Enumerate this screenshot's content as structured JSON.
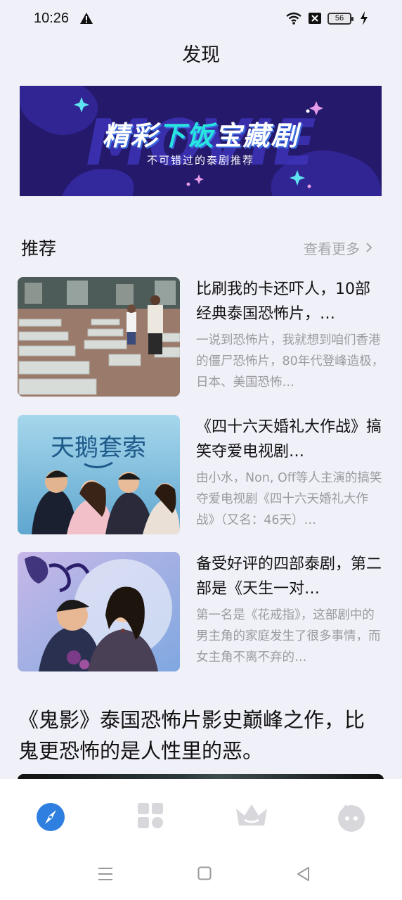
{
  "status_bar": {
    "time": "10:26",
    "battery": "56"
  },
  "header": {
    "title": "发现"
  },
  "banner": {
    "title_prefix": "精彩",
    "title_highlight": "下饭",
    "title_suffix": "宝藏剧",
    "watermark": "MOVIE",
    "subtitle": "不可错过的泰剧推荐"
  },
  "section": {
    "title": "推荐",
    "more_label": "查看更多"
  },
  "articles": [
    {
      "title": "比刷我的卡还吓人，10部经典泰国恐怖片，…",
      "desc": "一说到恐怖片，我就想到咱们香港的僵尸恐怖片，80年代登峰造极，日本、美国恐怖…"
    },
    {
      "title": "《四十六天婚礼大作战》搞笑夺爱电视剧…",
      "desc": "由小水，Non, Off等人主演的搞笑夺爱电视剧《四十六天婚礼大作战》（又名：46天）…",
      "image_caption": "天鹅套索"
    },
    {
      "title": "备受好评的四部泰剧，第二部是《天生一对…",
      "desc": "第一名是《花戒指》，这部剧中的男主角的家庭发生了很多事情，而女主角不离不弃的…"
    }
  ],
  "feature": {
    "title": "《鬼影》泰国恐怖片影史巅峰之作，比鬼更恐怖的是人性里的恶。"
  },
  "bottom_nav": {
    "items": [
      {
        "icon": "compass-icon",
        "active": true
      },
      {
        "icon": "grid-icon",
        "active": false
      },
      {
        "icon": "crown-icon",
        "active": false
      },
      {
        "icon": "profile-icon",
        "active": false
      }
    ]
  },
  "colors": {
    "accent": "#2f7fe0",
    "inactive": "#d8d8dc",
    "banner_bg": "#24196b",
    "highlight": "#27e6e0"
  }
}
